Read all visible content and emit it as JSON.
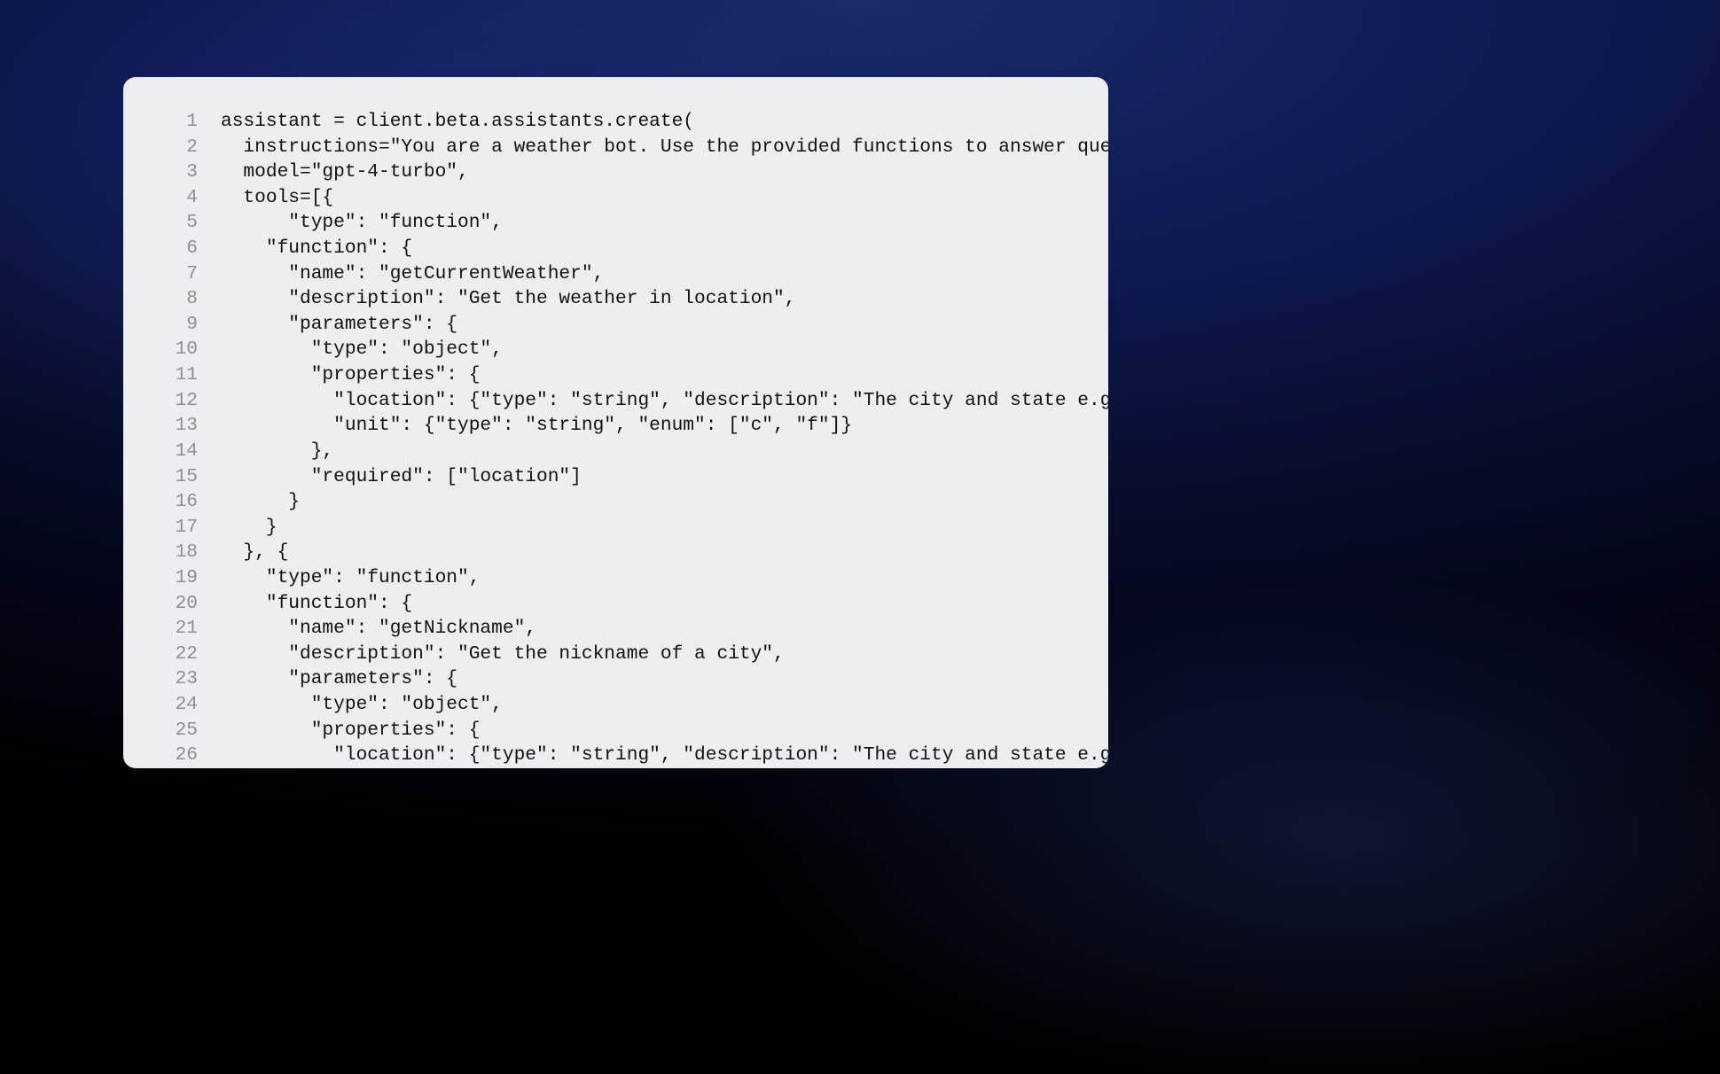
{
  "lines": [
    {
      "n": "1",
      "t": "assistant = client.beta.assistants.create("
    },
    {
      "n": "2",
      "t": "  instructions=\"You are a weather bot. Use the provided functions to answer questions.\","
    },
    {
      "n": "3",
      "t": "  model=\"gpt-4-turbo\","
    },
    {
      "n": "4",
      "t": "  tools=[{"
    },
    {
      "n": "5",
      "t": "      \"type\": \"function\","
    },
    {
      "n": "6",
      "t": "    \"function\": {"
    },
    {
      "n": "7",
      "t": "      \"name\": \"getCurrentWeather\","
    },
    {
      "n": "8",
      "t": "      \"description\": \"Get the weather in location\","
    },
    {
      "n": "9",
      "t": "      \"parameters\": {"
    },
    {
      "n": "10",
      "t": "        \"type\": \"object\","
    },
    {
      "n": "11",
      "t": "        \"properties\": {"
    },
    {
      "n": "12",
      "t": "          \"location\": {\"type\": \"string\", \"description\": \"The city and state e.g. San Francisco, CA"
    },
    {
      "n": "13",
      "t": "          \"unit\": {\"type\": \"string\", \"enum\": [\"c\", \"f\"]}"
    },
    {
      "n": "14",
      "t": "        },"
    },
    {
      "n": "15",
      "t": "        \"required\": [\"location\"]"
    },
    {
      "n": "16",
      "t": "      }"
    },
    {
      "n": "17",
      "t": "    }"
    },
    {
      "n": "18",
      "t": "  }, {"
    },
    {
      "n": "19",
      "t": "    \"type\": \"function\","
    },
    {
      "n": "20",
      "t": "    \"function\": {"
    },
    {
      "n": "21",
      "t": "      \"name\": \"getNickname\","
    },
    {
      "n": "22",
      "t": "      \"description\": \"Get the nickname of a city\","
    },
    {
      "n": "23",
      "t": "      \"parameters\": {"
    },
    {
      "n": "24",
      "t": "        \"type\": \"object\","
    },
    {
      "n": "25",
      "t": "        \"properties\": {"
    },
    {
      "n": "26",
      "t": "          \"location\": {\"type\": \"string\", \"description\": \"The city and state e.g. San Francisco, CA"
    }
  ]
}
